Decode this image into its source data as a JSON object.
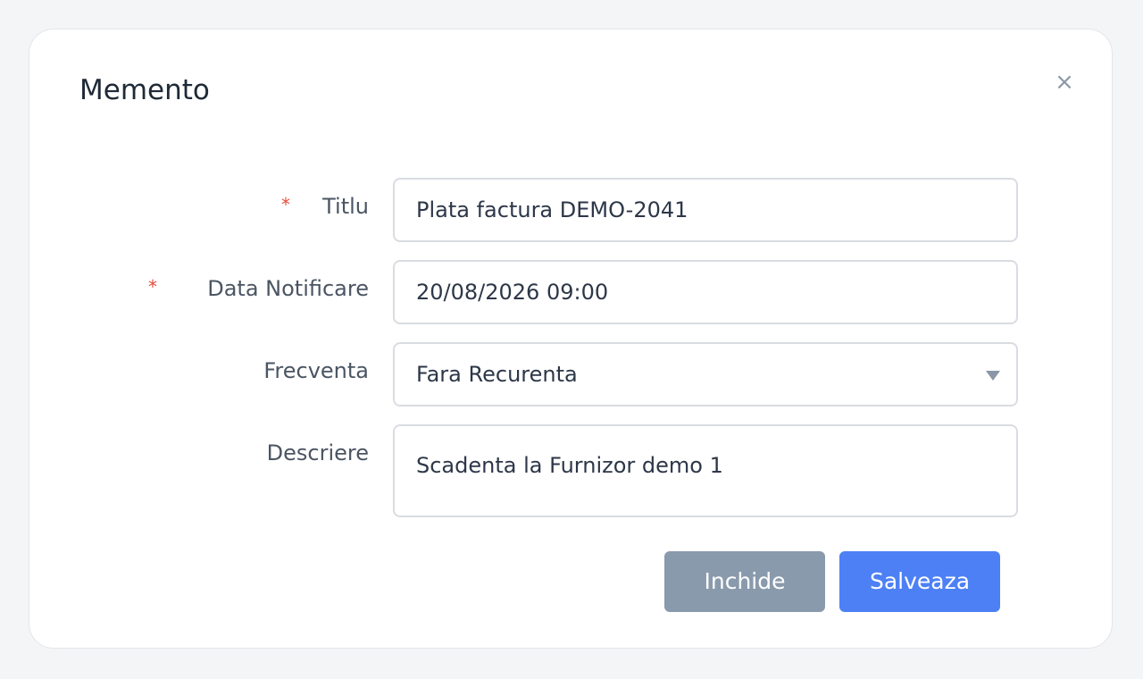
{
  "modal": {
    "title": "Memento",
    "close_icon": "×"
  },
  "form": {
    "title_field": {
      "label": "Titlu",
      "required": true,
      "value": "Plata factura DEMO-2041"
    },
    "notification_date_field": {
      "label": "Data Notificare",
      "required": true,
      "value": "20/08/2026 09:00"
    },
    "frequency_field": {
      "label": "Frecventa",
      "required": false,
      "value": "Fara Recurenta"
    },
    "description_field": {
      "label": "Descriere",
      "required": false,
      "value": "Scadenta la Furnizor demo 1"
    },
    "required_marker": "*"
  },
  "buttons": {
    "close_label": "Inchide",
    "save_label": "Salveaza"
  },
  "colors": {
    "primary": "#4d80f5",
    "secondary": "#8a9aad",
    "required": "#e74c3c"
  }
}
